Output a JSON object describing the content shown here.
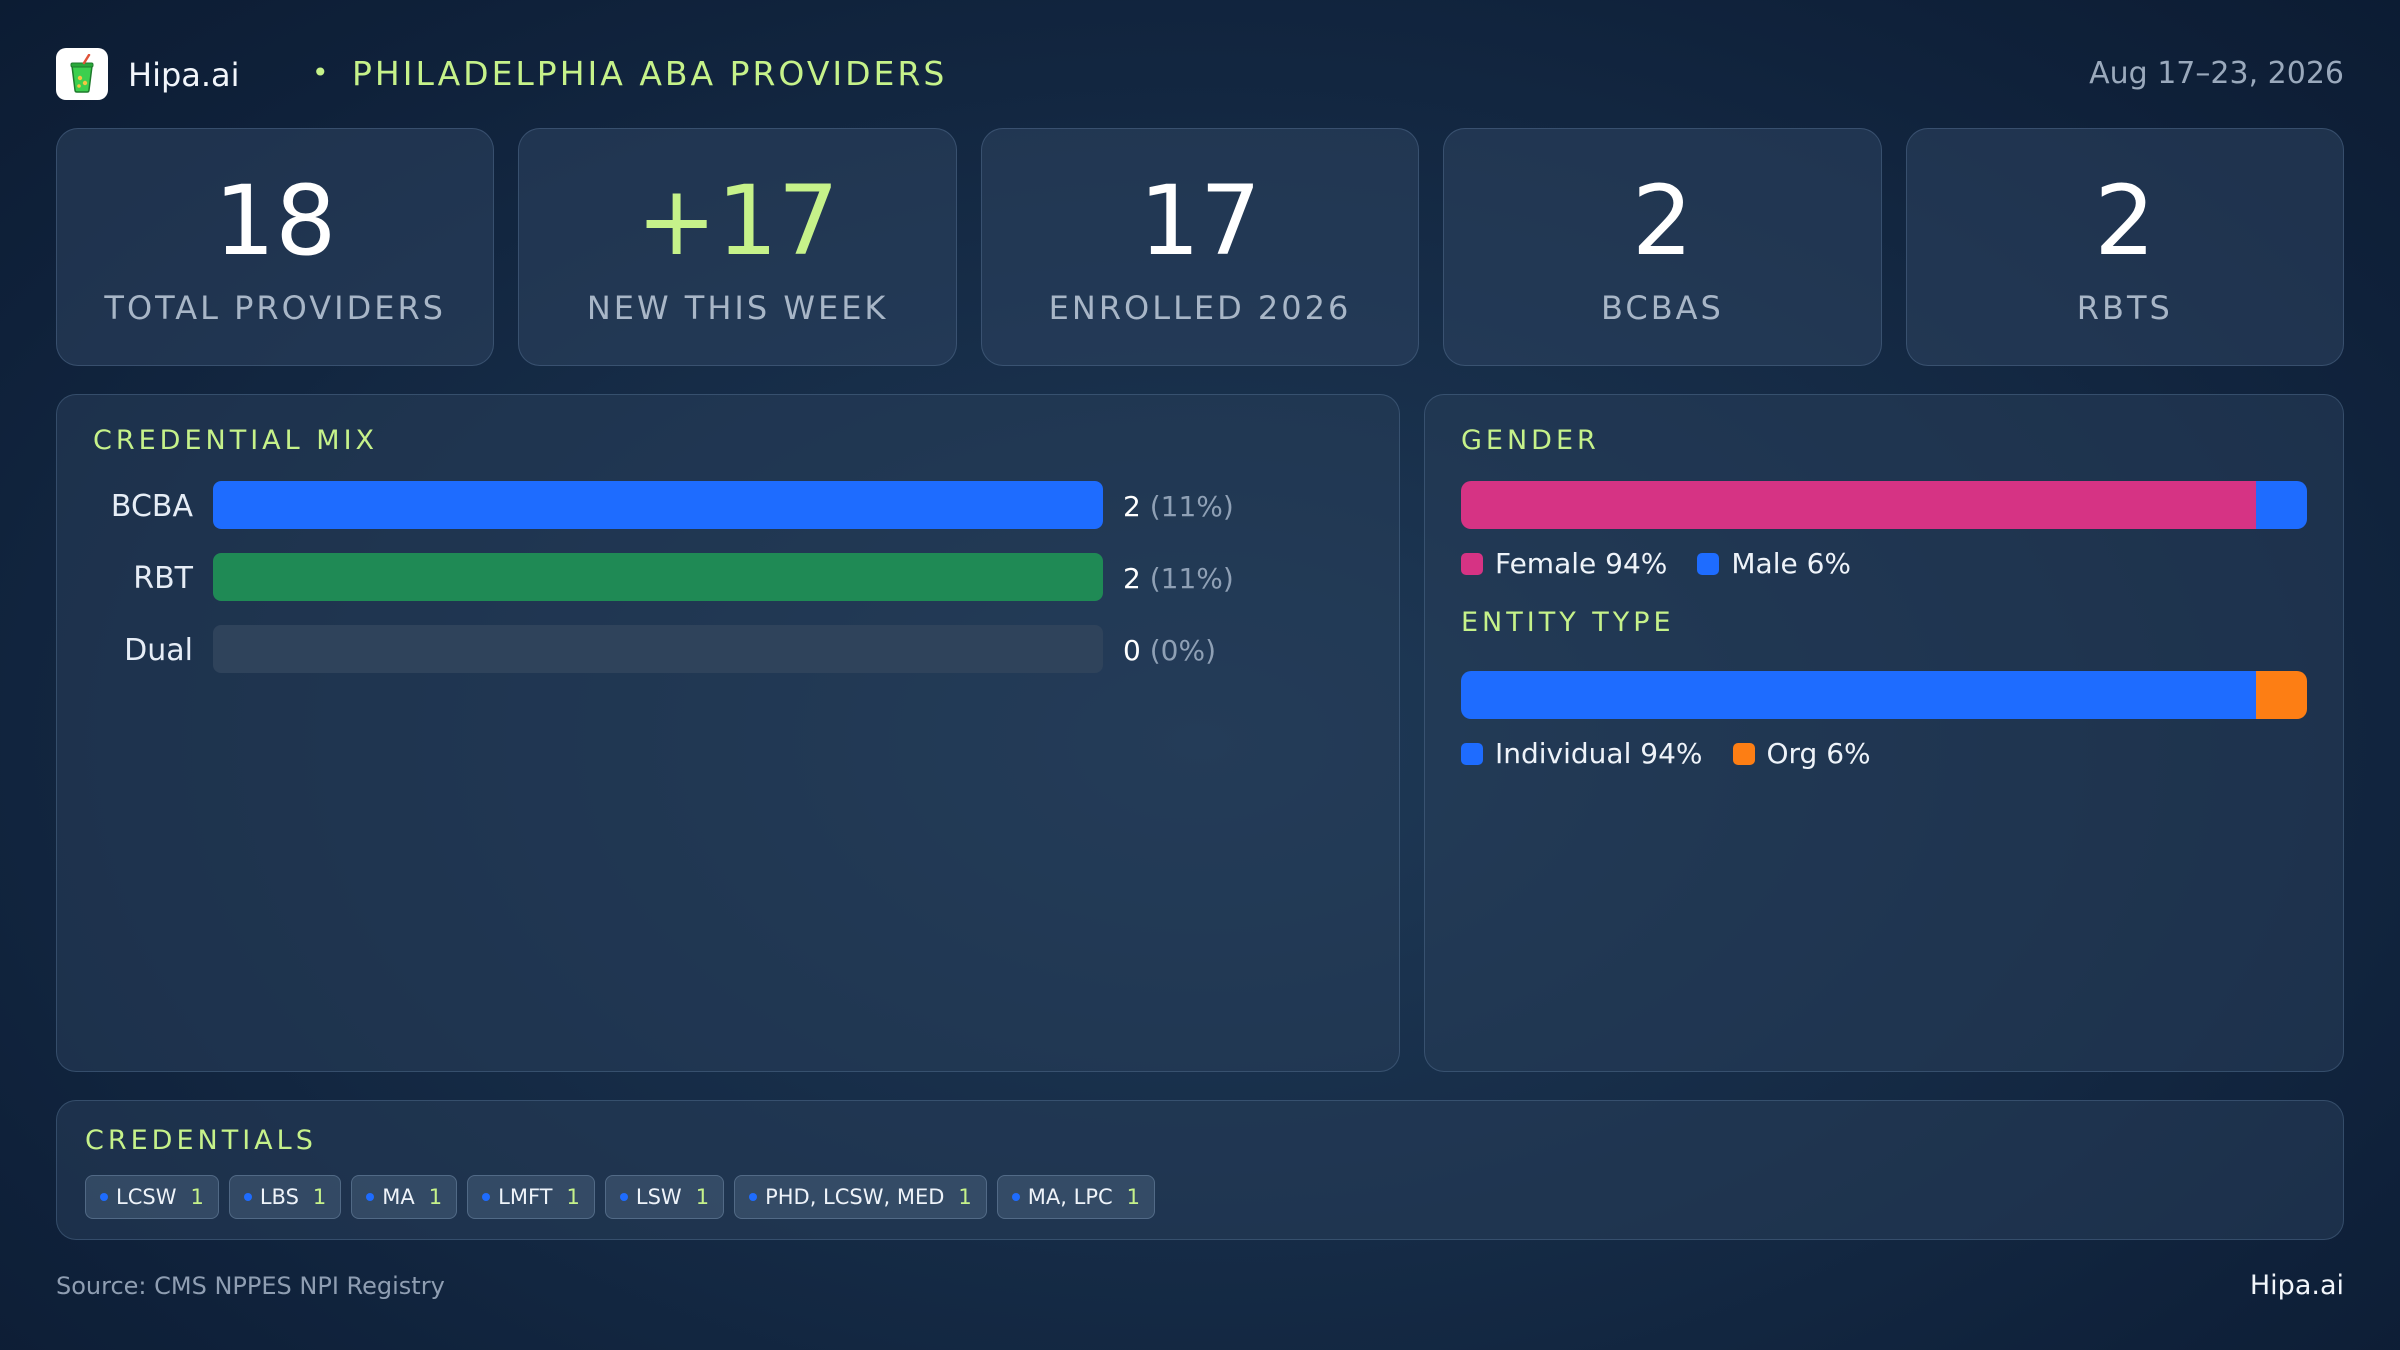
{
  "header": {
    "brand": "Hipa.ai",
    "separator": "•",
    "title": "PHILADELPHIA ABA PROVIDERS",
    "date_range": "Aug 17–23, 2026",
    "logo_icon": "drink-cup-icon"
  },
  "kpis": [
    {
      "value": "18",
      "label": "TOTAL PROVIDERS"
    },
    {
      "value": "+17",
      "label": "NEW THIS WEEK"
    },
    {
      "value": "17",
      "label": "ENROLLED 2026"
    },
    {
      "value": "2",
      "label": "BCBAS"
    },
    {
      "value": "2",
      "label": "RBTS"
    }
  ],
  "credential_mix": {
    "title": "CREDENTIAL MIX",
    "rows": [
      {
        "label": "BCBA",
        "count": "2",
        "pct": "(11%)",
        "fill": 1.0,
        "color": "#1e6cff"
      },
      {
        "label": "RBT",
        "count": "2",
        "pct": "(11%)",
        "fill": 1.0,
        "color": "#1f8a55"
      },
      {
        "label": "Dual",
        "count": "0",
        "pct": "(0%)",
        "fill": 0.0,
        "color": "#2f435b"
      }
    ]
  },
  "gender": {
    "title": "GENDER",
    "segments": [
      {
        "label": "Female 94%",
        "share": 94,
        "color": "#d63384"
      },
      {
        "label": "Male 6%",
        "share": 6,
        "color": "#1e6cff"
      }
    ]
  },
  "entity_type": {
    "title": "ENTITY TYPE",
    "segments": [
      {
        "label": "Individual 94%",
        "share": 94,
        "color": "#1e6cff"
      },
      {
        "label": "Org 6%",
        "share": 6,
        "color": "#fd7e14"
      }
    ]
  },
  "credentials": {
    "title": "CREDENTIALS",
    "chips": [
      {
        "name": "LCSW",
        "count": "1"
      },
      {
        "name": "LBS",
        "count": "1"
      },
      {
        "name": "MA",
        "count": "1"
      },
      {
        "name": "LMFT",
        "count": "1"
      },
      {
        "name": "LSW",
        "count": "1"
      },
      {
        "name": "PHD, LCSW, MED",
        "count": "1"
      },
      {
        "name": "MA, LPC",
        "count": "1"
      }
    ]
  },
  "footer": {
    "source": "Source: CMS NPPES NPI Registry",
    "brand": "Hipa.ai"
  },
  "colors": {
    "accent": "#c6f28a",
    "blue": "#1e6cff",
    "green": "#1f8a55",
    "pink": "#d63384",
    "orange": "#fd7e14"
  }
}
